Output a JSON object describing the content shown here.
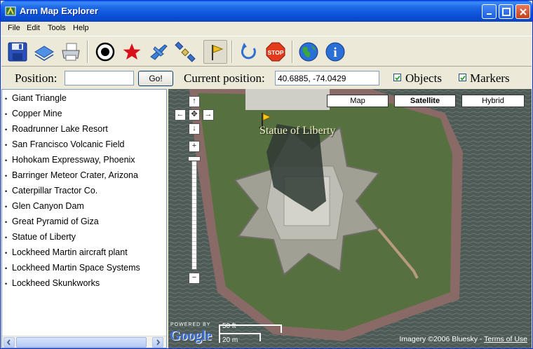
{
  "window": {
    "title": "Arm Map Explorer"
  },
  "menu": [
    "File",
    "Edit",
    "Tools",
    "Help"
  ],
  "toolbar": {
    "icons": [
      "save-icon",
      "layers-icon",
      "print-icon",
      "target-icon",
      "star-icon",
      "airplane-icon",
      "satellite-icon",
      "flag-icon",
      "refresh-icon",
      "stop-icon",
      "globe-icon",
      "info-icon"
    ],
    "stop_label": "STOP",
    "info_label": "i"
  },
  "position_bar": {
    "position_label": "Position:",
    "position_value": "",
    "go_label": "Go!",
    "current_label": "Current position:",
    "current_value": "40.6885, -74.0429",
    "objects_label": "Objects",
    "objects_checked": true,
    "markers_label": "Markers",
    "markers_checked": true
  },
  "places": [
    "Giant Triangle",
    "Copper Mine",
    "Roadrunner Lake Resort",
    "San Francisco Volcanic Field",
    "Hohokam Expressway, Phoenix",
    "Barringer Meteor Crater, Arizona",
    "Caterpillar Tractor Co.",
    "Glen Canyon Dam",
    "Great Pyramid of Giza",
    "Statue of Liberty",
    "Lockheed Martin aircraft plant",
    "Lockheed Martin Space Systems",
    "Lockheed Skunkworks"
  ],
  "map": {
    "types": [
      "Map",
      "Satellite",
      "Hybrid"
    ],
    "active_type": "Satellite",
    "marker_label": "Statue of Liberty",
    "nav": {
      "up": "↑",
      "down": "↓",
      "left": "←",
      "right": "→",
      "center": "✥",
      "zoom_in": "+",
      "zoom_out": "−"
    },
    "zoom_level_fraction": 0.0,
    "powered_by": "POWERED BY",
    "google_logo": "Google",
    "scale_ft": "50 ft",
    "scale_m": "20 m",
    "credit_prefix": "Imagery ©2006 Bluesky - ",
    "credit_link": "Terms of Use"
  }
}
